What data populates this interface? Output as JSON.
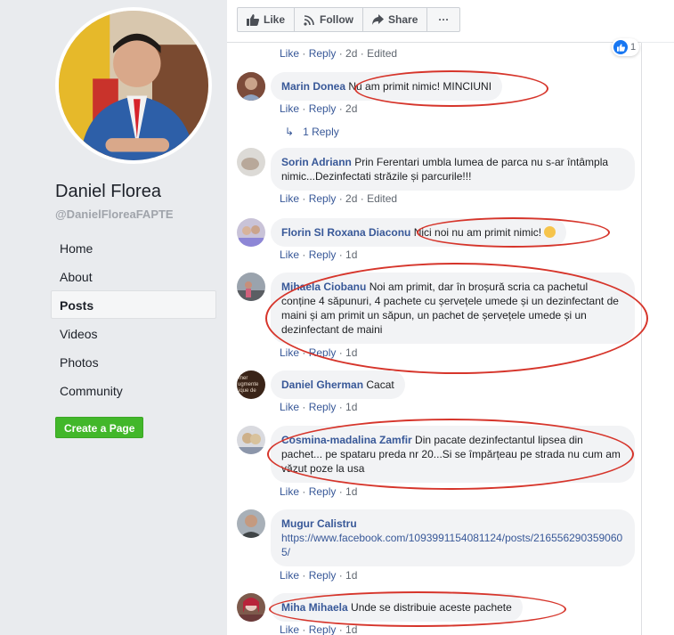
{
  "sidebar": {
    "page_name": "Daniel Florea",
    "handle": "@DanielFloreaFAPTE",
    "nav": [
      {
        "label": "Home",
        "active": false
      },
      {
        "label": "About",
        "active": false
      },
      {
        "label": "Posts",
        "active": true
      },
      {
        "label": "Videos",
        "active": false
      },
      {
        "label": "Photos",
        "active": false
      },
      {
        "label": "Community",
        "active": false
      }
    ],
    "create_page_label": "Create a Page"
  },
  "actions": {
    "like": "Like",
    "follow": "Follow",
    "share": "Share",
    "more": "···"
  },
  "top_comment_meta": {
    "like": "Like",
    "reply": "Reply",
    "time": "2d",
    "edited": "Edited",
    "reaction_count": "1"
  },
  "comments": [
    {
      "author": "Marin Donea",
      "text": "Nu am primit nimic! MINCIUNI",
      "like": "Like",
      "reply": "Reply",
      "time": "2d",
      "replies_label": "1 Reply"
    },
    {
      "author": "Sorin Adriann",
      "text": "Prin Ferentari umbla lumea de parca nu s-ar întâmpla nimic...Dezinfectati străzile și parcurile!!!",
      "like": "Like",
      "reply": "Reply",
      "time": "2d",
      "edited": "Edited"
    },
    {
      "author": "Florin SI Roxana Diaconu",
      "text": "Nici noi nu am primit nimic!",
      "like": "Like",
      "reply": "Reply",
      "time": "1d"
    },
    {
      "author": "Mihaela Ciobanu",
      "text": "Noi am primit, dar în broșură scria ca pachetul conține 4 săpunuri, 4 pachete cu șervețele umede și un dezinfectant de maini și am primit un săpun, un pachet de șervețele umede și un dezinfectant de maini",
      "like": "Like",
      "reply": "Reply",
      "time": "1d"
    },
    {
      "author": "Daniel Gherman",
      "text": "Cacat",
      "like": "Like",
      "reply": "Reply",
      "time": "1d"
    },
    {
      "author": "Cosmina-madalina Zamfir",
      "text": "Din pacate dezinfectantul lipsea din pachet... pe spataru preda nr 20...Si se împărțeau pe strada nu cum am văzut poze la usa",
      "like": "Like",
      "reply": "Reply",
      "time": "1d"
    },
    {
      "author": "Mugur Calistru",
      "link": "https://www.facebook.com/1093991154081124/posts/2165562903590605/",
      "like": "Like",
      "reply": "Reply",
      "time": "1d"
    },
    {
      "author": "Miha Mihaela",
      "text": "Unde se distribuie aceste pachete",
      "like": "Like",
      "reply": "Reply",
      "time": "1d"
    }
  ],
  "avatar_text": {
    "daniel_gherman": "Numer Argumente Fabrique de Venir"
  },
  "colors": {
    "link": "#385898",
    "annotation": "#d6352b",
    "create_button": "#42b72a"
  }
}
